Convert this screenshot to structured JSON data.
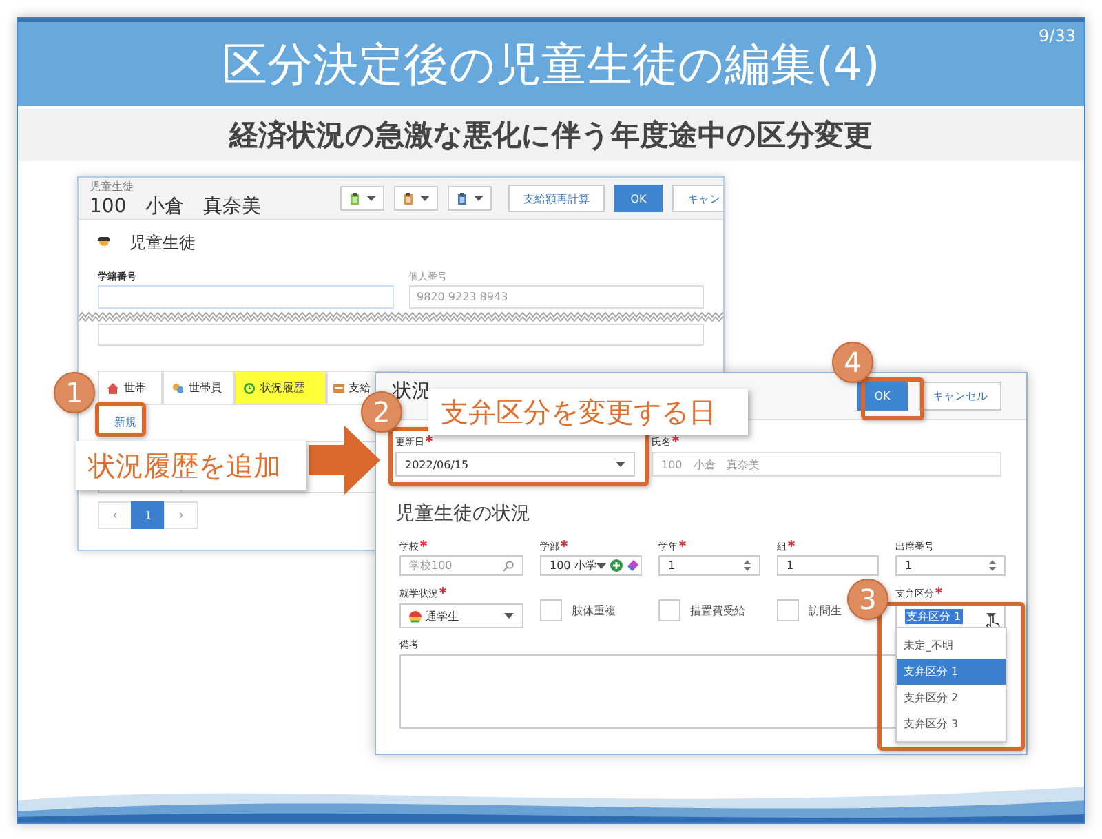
{
  "slide": {
    "title": "区分決定後の児童生徒の編集(4)",
    "page_number": "9/33",
    "subtitle": "経済状況の急激な悪化に伴う年度途中の区分変更"
  },
  "student_window": {
    "caption": "児童生徒",
    "heading": "100　小倉　真奈美",
    "toolbar_menus": [
      {
        "color": "#7cc243"
      },
      {
        "color": "#e0953a"
      },
      {
        "color": "#3b78c4"
      }
    ],
    "buttons": [
      {
        "label": "支給額再計算",
        "kind": "default"
      },
      {
        "label": "OK",
        "kind": "primary"
      },
      {
        "label": "キャン",
        "kind": "default"
      }
    ],
    "section": "児童生徒",
    "fields": [
      {
        "label": "学籍番号",
        "disabled": false
      },
      {
        "label": "個人番号",
        "value": "9820 9223 8943",
        "disabled": true
      }
    ],
    "tabs": [
      {
        "label": "世帯",
        "selected": false
      },
      {
        "label": "世帯員",
        "selected": false
      },
      {
        "label": "状況履歴",
        "selected": true
      },
      {
        "label": "支給",
        "selected": false
      }
    ],
    "new_link": "新規",
    "pager": [
      {
        "label": "‹",
        "selected": false
      },
      {
        "label": "1",
        "selected": true
      },
      {
        "label": "›",
        "selected": false
      }
    ]
  },
  "status_dialog": {
    "title": "状況",
    "buttons": [
      {
        "label": "OK",
        "kind": "primary"
      },
      {
        "label": "キャンセル",
        "kind": "default"
      }
    ],
    "top_fields": [
      {
        "label": "更新日",
        "required": true,
        "kind": "dropdown",
        "value": "2022/06/15"
      },
      {
        "label": "氏名",
        "required": true,
        "kind": "readonly",
        "value": "100　小倉　真奈美"
      }
    ],
    "section": "児童生徒の状況",
    "row_fields": [
      {
        "label": "学校",
        "required": true,
        "kind": "search",
        "placeholder": "学校100"
      },
      {
        "label": "学部",
        "required": true,
        "kind": "combo",
        "value": "100 小学"
      },
      {
        "label": "学年",
        "required": true,
        "kind": "spinner",
        "value": "1"
      },
      {
        "label": "組",
        "required": true,
        "kind": "text",
        "value": "1"
      },
      {
        "label": "出席番号",
        "required": false,
        "kind": "spinner",
        "value": "1"
      }
    ],
    "status_row": [
      {
        "kind": "dropdown",
        "label": "就学状況",
        "required": true,
        "value": "通学生"
      },
      {
        "kind": "checkbox",
        "label": "肢体重複",
        "checked": false
      },
      {
        "kind": "checkbox",
        "label": "措置費受給",
        "checked": false
      },
      {
        "kind": "checkbox",
        "label": "訪問生",
        "checked": false
      },
      {
        "kind": "select",
        "label": "支弁区分",
        "required": true,
        "value": "支弁区分 1",
        "expanded": true,
        "options": [
          {
            "label": "未定_不明",
            "selected": false
          },
          {
            "label": "支弁区分 1",
            "selected": true
          },
          {
            "label": "支弁区分 2",
            "selected": false
          },
          {
            "label": "支弁区分 3",
            "selected": false
          }
        ]
      }
    ],
    "remarks": {
      "label": "備考"
    }
  },
  "annotations": {
    "markers": [
      "1",
      "2",
      "3",
      "4"
    ],
    "notes": [
      "状況履歴を追加",
      "支弁区分を変更する日"
    ]
  }
}
